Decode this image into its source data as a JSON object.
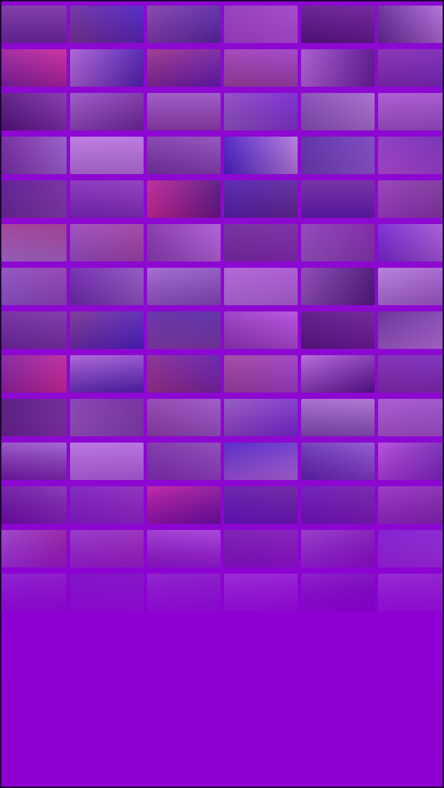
{
  "wallpaper": {
    "accent_color": "#8e00d2",
    "thumbnail_palette": [
      "#5b2a8a",
      "#6a3a7a",
      "#7b4a9a",
      "#8a3fb0",
      "#3a1060",
      "#4b2a7a",
      "#6c1f8f",
      "#b07ad8",
      "#9a3a6a",
      "#a0508a",
      "#c080e0",
      "#7a2fa0",
      "#2a0a50",
      "#9a6ac0",
      "#8a4a9a",
      "#8e6ab8",
      "#7a5aa8",
      "#b06ad0",
      "#5a1a80",
      "#c89ae8",
      "#6a3a90",
      "#2a20c0",
      "#3a2a90",
      "#c060e0",
      "#3a0a70",
      "#6a2ab0",
      "#e02a80",
      "#3020a0",
      "#4a1aa0",
      "#a04ac0",
      "#b090d0",
      "#9a60c0",
      "#7a3a9a",
      "#5a2a80",
      "#9a6ac0",
      "#6a2ad0",
      "#8a70d0",
      "#5a2aa0",
      "#a080d0",
      "#c090e0",
      "#8a60b0",
      "#c0a0e0"
    ]
  }
}
